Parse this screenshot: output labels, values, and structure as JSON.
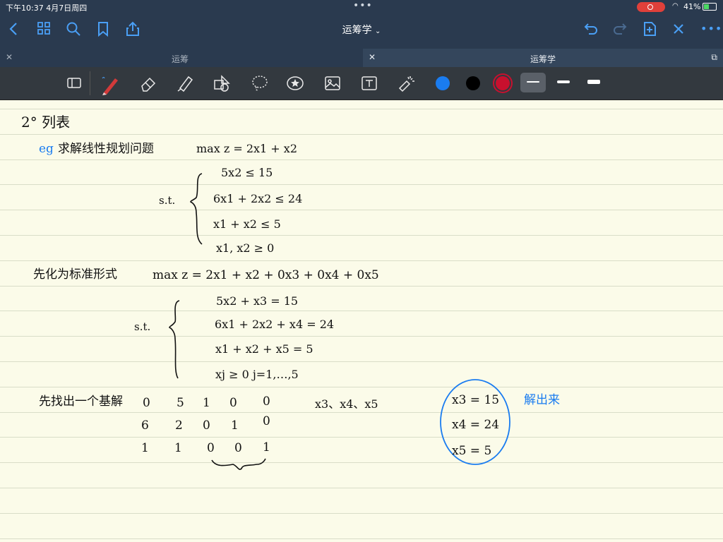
{
  "status_bar": {
    "time_date": "下午10:37  4月7日周四",
    "battery": "41%"
  },
  "nav": {
    "title": "运筹学"
  },
  "tabs": [
    {
      "label": "运筹"
    },
    {
      "label": "运筹学"
    }
  ],
  "toolbar": {
    "colors": [
      "#1a7cf0",
      "#000000",
      "#c8102e"
    ]
  },
  "notes": {
    "heading": "2° 列表",
    "eg_prefix": "eg",
    "problem": "求解线性规划问题",
    "objective1": "max z = 2x1 + x2",
    "st1": "s.t.",
    "c1": "5x2 ≤ 15",
    "c2": "6x1 + 2x2 ≤ 24",
    "c3": "x1 + x2 ≤ 5",
    "c4": "x1, x2 ≥ 0",
    "standard_label": "先化为标准形式",
    "objective2": "max z = 2x1 + x2 + 0x3 + 0x4 + 0x5",
    "st2": "s.t.",
    "e1": "5x2 + x3 = 15",
    "e2": "6x1 + 2x2 + x4 = 24",
    "e3": "x1 + x2 + x5 = 5",
    "e4": "xj ≥ 0   j=1,…,5",
    "basis_label": "先找出一个基解",
    "row1": [
      "0",
      "5",
      "1",
      "0",
      "0"
    ],
    "row2": [
      "6",
      "2",
      "0",
      "1",
      "0"
    ],
    "row3": [
      "1",
      "1",
      "0",
      "0",
      "1"
    ],
    "basic_vars": "x3、x4、x5",
    "sol1": "x3 = 15",
    "sol2": "x4 = 24",
    "sol3": "x5 = 5",
    "side_note": "解出来"
  }
}
